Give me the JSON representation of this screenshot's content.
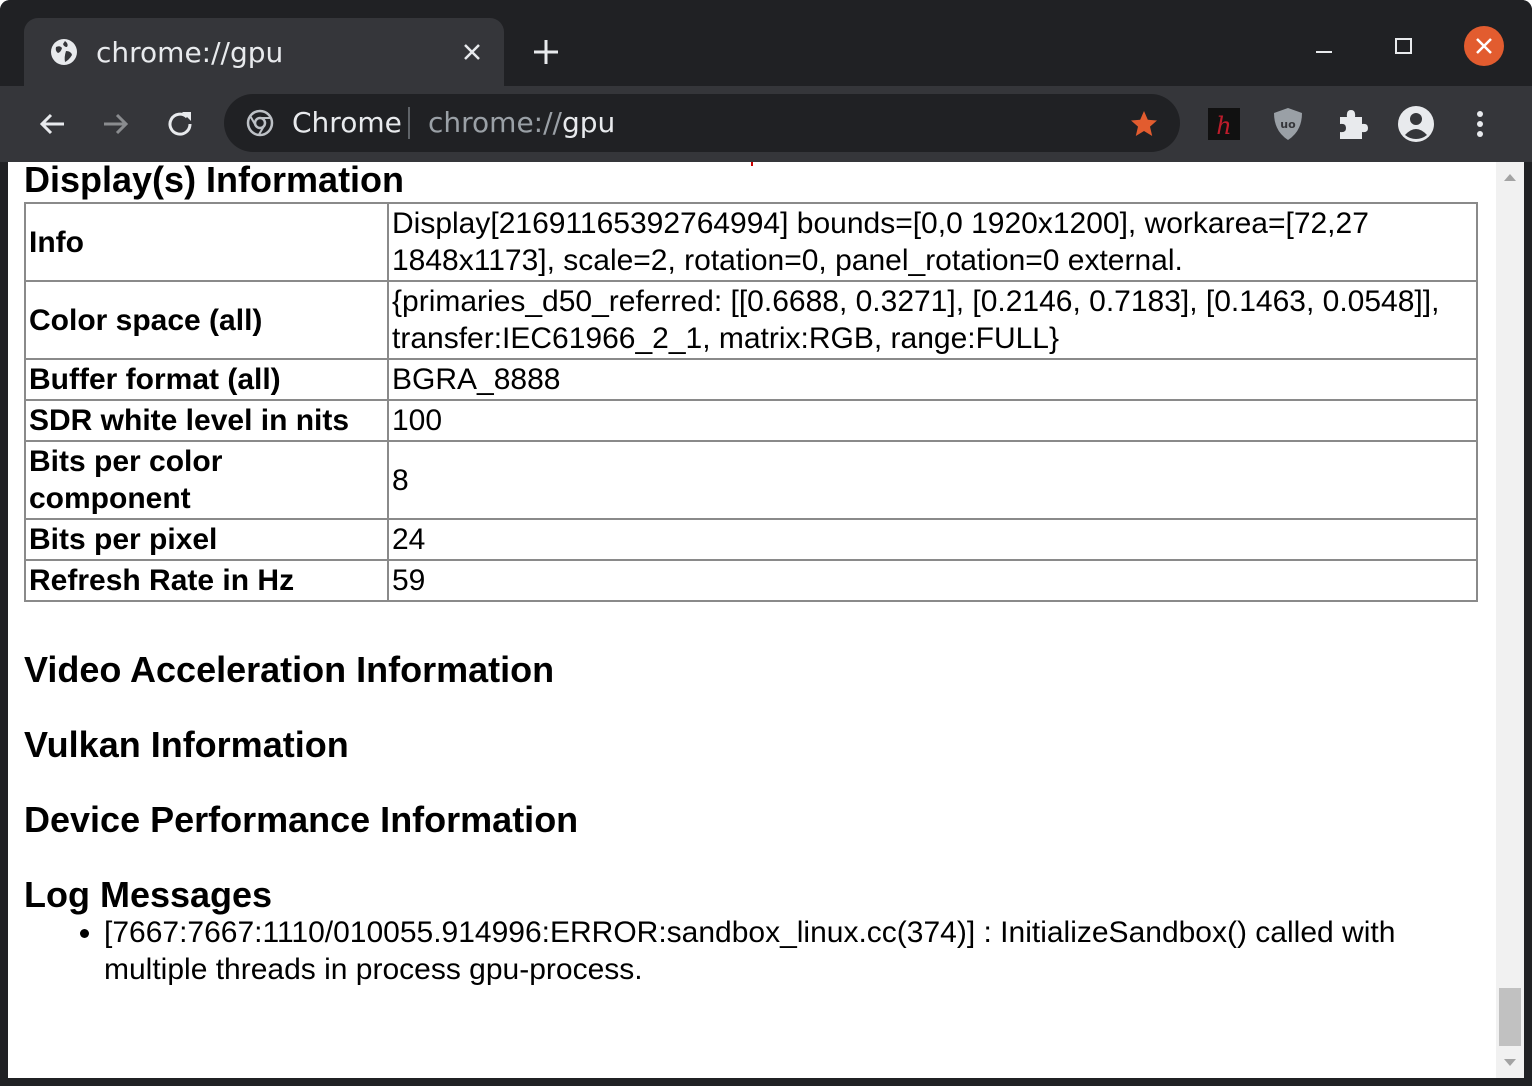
{
  "browser": {
    "tab": {
      "title": "chrome://gpu"
    },
    "omnibox": {
      "chip": "Chrome",
      "url_scheme": "chrome://",
      "url_host": "gpu"
    },
    "icons": [
      "globe-icon",
      "close-icon",
      "plus-icon",
      "minimize-icon",
      "maximize-icon",
      "back-icon",
      "forward-icon",
      "reload-icon",
      "chrome-icon",
      "star-icon",
      "hypothesis-extension-icon",
      "ublock-extension-icon",
      "puzzle-icon",
      "profile-icon",
      "kebab-menu-icon"
    ],
    "colors": {
      "frame": "#202124",
      "toolbar": "#35363a",
      "close_button": "#e25c2f",
      "star": "#e25c2f"
    }
  },
  "sections": {
    "display_title": "Display(s) Information",
    "display_rows": [
      {
        "key": "Info",
        "value": "Display[21691165392764994] bounds=[0,0 1920x1200], workarea=[72,27 1848x1173], scale=2, rotation=0, panel_rotation=0 external."
      },
      {
        "key": "Color space (all)",
        "value": "{primaries_d50_referred: [[0.6688, 0.3271], [0.2146, 0.7183], [0.1463, 0.0548]], transfer:IEC61966_2_1, matrix:RGB, range:FULL}"
      },
      {
        "key": "Buffer format (all)",
        "value": "BGRA_8888"
      },
      {
        "key": "SDR white level in nits",
        "value": "100"
      },
      {
        "key": "Bits per color component",
        "value": "8"
      },
      {
        "key": "Bits per pixel",
        "value": "24"
      },
      {
        "key": "Refresh Rate in Hz",
        "value": "59"
      }
    ],
    "video_title": "Video Acceleration Information",
    "vulkan_title": "Vulkan Information",
    "perf_title": "Device Performance Information",
    "log_title": "Log Messages",
    "log_messages": [
      "[7667:7667:1110/010055.914996:ERROR:sandbox_linux.cc(374)] : InitializeSandbox() called with multiple threads in process gpu-process."
    ]
  }
}
